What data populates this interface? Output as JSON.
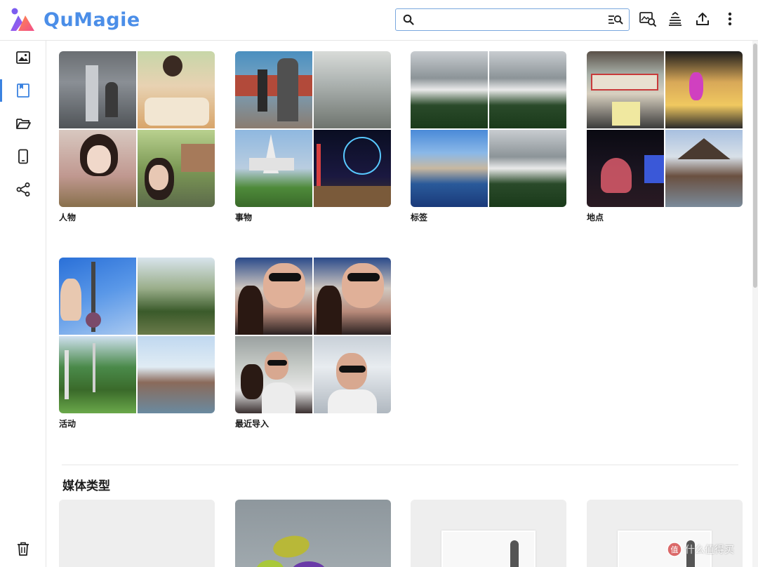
{
  "app": {
    "name": "QuMagie",
    "brand_color": "#4b8ee8"
  },
  "search": {
    "placeholder": "",
    "value": ""
  },
  "header_actions": [
    {
      "icon": "image-search-icon"
    },
    {
      "icon": "stack-icon"
    },
    {
      "icon": "upload-icon"
    },
    {
      "icon": "more-vertical-icon"
    }
  ],
  "sidebar": {
    "items": [
      {
        "icon": "photos-icon",
        "active": false
      },
      {
        "icon": "albums-icon",
        "active": true
      },
      {
        "icon": "folder-icon",
        "active": false
      },
      {
        "icon": "device-icon",
        "active": false
      },
      {
        "icon": "share-icon",
        "active": false
      }
    ],
    "trash_icon": "trash-icon",
    "accent": "#3b82e0"
  },
  "smart_albums": [
    {
      "label": "人物"
    },
    {
      "label": "事物"
    },
    {
      "label": "标签"
    },
    {
      "label": "地点"
    },
    {
      "label": "活动"
    },
    {
      "label": "最近导入"
    }
  ],
  "media_types": {
    "title": "媒体类型"
  },
  "watermark": {
    "text": "什么值得买"
  }
}
